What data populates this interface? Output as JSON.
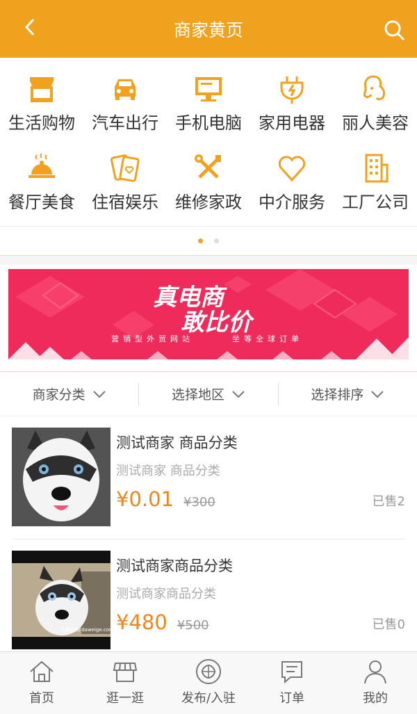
{
  "header": {
    "title": "商家黄页"
  },
  "categories": [
    {
      "label": "生活购物",
      "icon": "shop-icon"
    },
    {
      "label": "汽车出行",
      "icon": "car-icon"
    },
    {
      "label": "手机电脑",
      "icon": "monitor-icon"
    },
    {
      "label": "家用电器",
      "icon": "plug-icon"
    },
    {
      "label": "丽人美容",
      "icon": "woman-icon"
    },
    {
      "label": "餐厅美食",
      "icon": "cloche-icon"
    },
    {
      "label": "住宿娱乐",
      "icon": "cards-icon"
    },
    {
      "label": "维修家政",
      "icon": "tools-icon"
    },
    {
      "label": "中介服务",
      "icon": "heart-icon"
    },
    {
      "label": "工厂公司",
      "icon": "building-icon"
    }
  ],
  "banner": {
    "line1": "真电商",
    "line2": "敢比价",
    "sub_left": "营销型外贸网站",
    "sub_right": "坐等全球订单"
  },
  "filters": [
    {
      "label": "商家分类"
    },
    {
      "label": "选择地区"
    },
    {
      "label": "选择排序"
    }
  ],
  "items": [
    {
      "name": "测试商家 商品分类",
      "sub": "测试商家 商品分类",
      "price": "¥0.01",
      "orig": "¥300",
      "sold": "已售2"
    },
    {
      "name": "测试商家商品分类",
      "sub": "测试商家商品分类",
      "price": "¥480",
      "orig": "¥500",
      "sold": "已售0",
      "watermark": "大黑鹅网 daweige.com"
    }
  ],
  "tabs": [
    {
      "label": "首页",
      "icon": "home-icon"
    },
    {
      "label": "逛一逛",
      "icon": "store-icon"
    },
    {
      "label": "发布/入驻",
      "icon": "publish-icon"
    },
    {
      "label": "订单",
      "icon": "message-icon"
    },
    {
      "label": "我的",
      "icon": "user-icon"
    }
  ],
  "colors": {
    "accent": "#f0a21e",
    "price": "#f08519",
    "banner": "#ee2b5a"
  }
}
